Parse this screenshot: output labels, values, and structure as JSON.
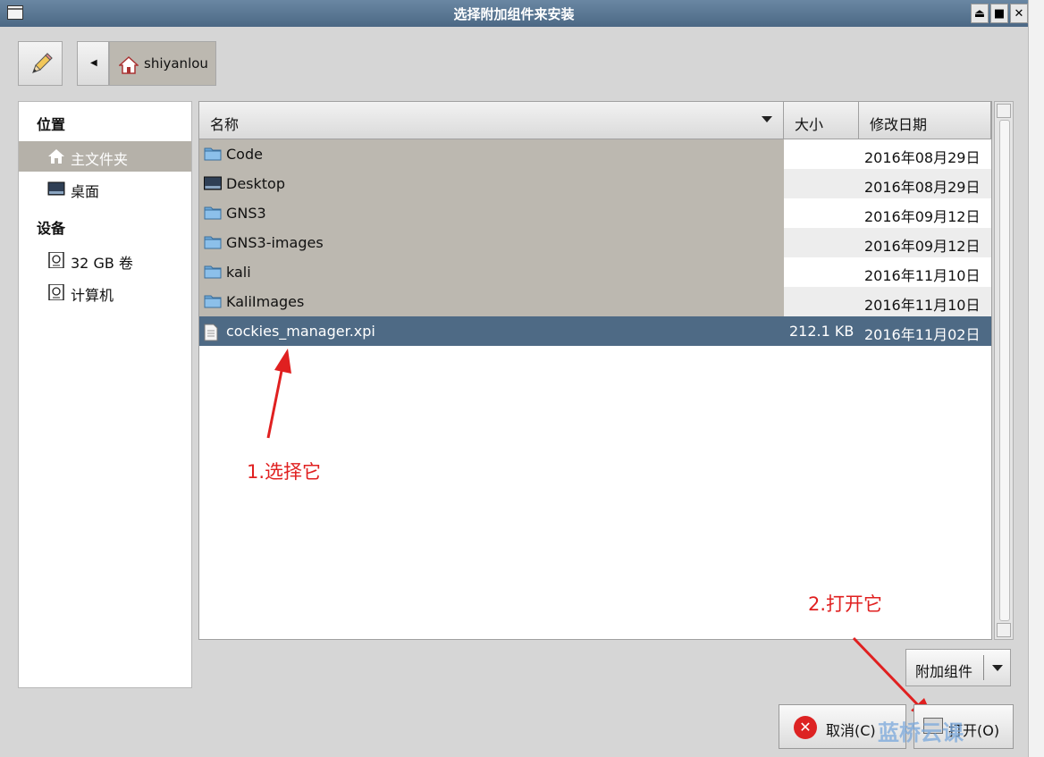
{
  "window": {
    "title": "选择附加组件来安装"
  },
  "titlebar_buttons": [
    "⏏",
    "■",
    "✕"
  ],
  "toolbar": {
    "location_crumb": "shiyanlou"
  },
  "sidebar": {
    "places_header": "位置",
    "places": [
      {
        "label": "主文件夹",
        "icon": "home-icon",
        "selected": true
      },
      {
        "label": "桌面",
        "icon": "desktop-icon",
        "selected": false
      }
    ],
    "devices_header": "设备",
    "devices": [
      {
        "label": "32 GB 卷",
        "icon": "drive-icon"
      },
      {
        "label": "计算机",
        "icon": "drive-icon"
      }
    ]
  },
  "file_list": {
    "columns": {
      "name": "名称",
      "size": "大小",
      "modified": "修改日期"
    },
    "rows": [
      {
        "name": "Code",
        "size": "",
        "modified": "2016年08月29日",
        "icon": "folder-icon"
      },
      {
        "name": "Desktop",
        "size": "",
        "modified": "2016年08月29日",
        "icon": "desktop-folder-icon"
      },
      {
        "name": "GNS3",
        "size": "",
        "modified": "2016年09月12日",
        "icon": "folder-icon"
      },
      {
        "name": "GNS3-images",
        "size": "",
        "modified": "2016年09月12日",
        "icon": "folder-icon"
      },
      {
        "name": "kali",
        "size": "",
        "modified": "2016年11月10日",
        "icon": "folder-icon"
      },
      {
        "name": "KaliImages",
        "size": "",
        "modified": "2016年11月10日",
        "icon": "folder-icon"
      },
      {
        "name": "cockies_manager.xpi",
        "size": "212.1 KB",
        "modified": "2016年11月02日",
        "icon": "file-icon",
        "selected": true
      }
    ]
  },
  "annotations": {
    "step1": "1.选择它",
    "step2": "2.打开它"
  },
  "filter": {
    "label": "附加组件"
  },
  "buttons": {
    "cancel": "取消(C)",
    "open": "打开(O)"
  },
  "watermark": "蓝桥云课",
  "colors": {
    "selection": "#4e6a85",
    "annotation": "#e02020",
    "titlebar": "#5a7794"
  }
}
